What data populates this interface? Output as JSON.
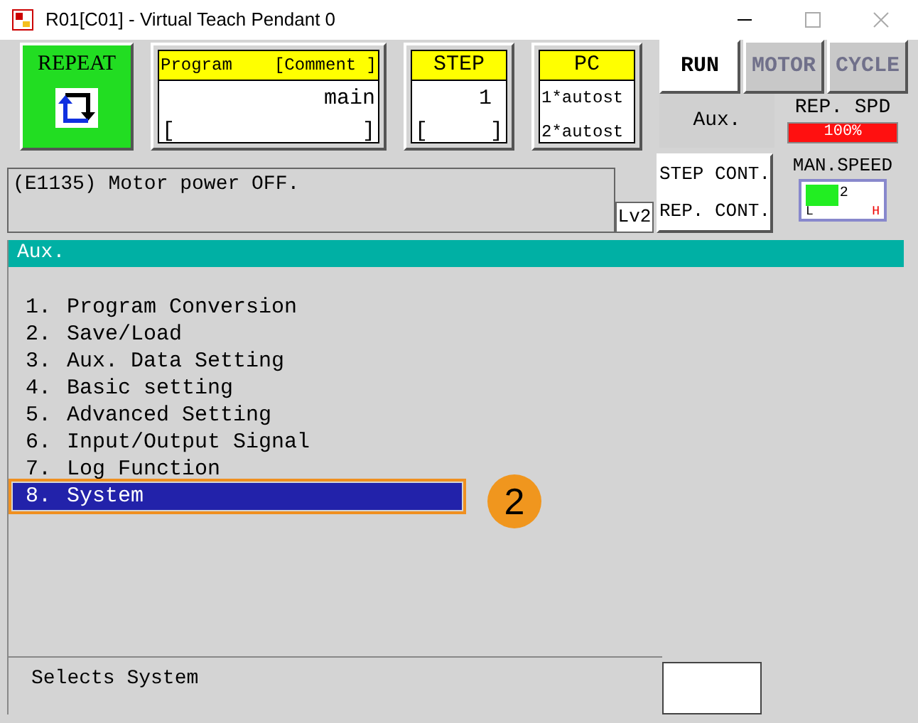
{
  "window": {
    "title": "R01[C01] - Virtual Teach Pendant 0"
  },
  "mode": {
    "label": "REPEAT"
  },
  "program": {
    "header": "Program",
    "comment_header": "[Comment ]",
    "value": "main",
    "comment_open": "[",
    "comment_close": "]"
  },
  "step": {
    "header": "STEP",
    "value": "1",
    "comment_open": "[",
    "comment_close": "]"
  },
  "pc": {
    "header": "PC",
    "lines": [
      "1*autost",
      "2*autost"
    ]
  },
  "buttons": [
    {
      "label": "RUN",
      "disabled": false
    },
    {
      "label": "MOTOR",
      "disabled": true
    },
    {
      "label": "CYCLE",
      "disabled": true
    }
  ],
  "aux_label": "Aux.",
  "rep_speed": {
    "label": "REP. SPD",
    "reading": "100%",
    "level": 1
  },
  "message": "(E1135) Motor power OFF.",
  "level_badge": "Lv2",
  "cont_modes": [
    "STEP CONT.",
    "REP. CONT."
  ],
  "man_speed": {
    "label": "MAN.SPEED",
    "reading": "2",
    "level": 0.45,
    "low": "L",
    "high": "H"
  },
  "menu": {
    "title": "Aux.",
    "items": [
      {
        "number": "1.",
        "label": "Program Conversion",
        "selected": false
      },
      {
        "number": "2.",
        "label": "Save/Load",
        "selected": false
      },
      {
        "number": "3.",
        "label": "Aux. Data Setting",
        "selected": false
      },
      {
        "number": "4.",
        "label": "Basic setting",
        "selected": false
      },
      {
        "number": "5.",
        "label": "Advanced Setting",
        "selected": false
      },
      {
        "number": "6.",
        "label": "Input/Output Signal",
        "selected": false
      },
      {
        "number": "7.",
        "label": "Log Function",
        "selected": false
      },
      {
        "number": "8.",
        "label": "System",
        "selected": true
      }
    ]
  },
  "annotation": {
    "label": "2"
  },
  "status": "Selects System"
}
